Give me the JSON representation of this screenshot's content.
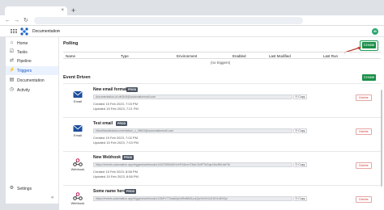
{
  "browser": {
    "tab_close": "×",
    "new_tab": "+",
    "back_glyph": "←",
    "forward_glyph": "→",
    "reload_glyph": "↻"
  },
  "header": {
    "workspace": "Documentation",
    "chevron": "⌄",
    "avatar_initial": "M"
  },
  "sidebar": {
    "items": [
      {
        "label": "Home",
        "icon": "⌂"
      },
      {
        "label": "Tasks",
        "icon": "☑"
      },
      {
        "label": "Pipeline",
        "icon": "⇄"
      },
      {
        "label": "Triggers",
        "icon": "⚡"
      },
      {
        "label": "Documentation",
        "icon": "▤"
      },
      {
        "label": "Activity",
        "icon": "◷"
      }
    ],
    "settings": {
      "label": "Settings",
      "icon": "⚙"
    },
    "collapse_glyph": "«",
    "active_index": 3
  },
  "polling": {
    "title": "Polling",
    "create_label": "Create",
    "columns": [
      "Name",
      "Type",
      "Environment",
      "Enabled",
      "Last Modified",
      "Last Run"
    ],
    "empty_text": "(no triggers)"
  },
  "event_driven": {
    "title": "Event Driven",
    "create_label": "Create",
    "cards": [
      {
        "name": "New email format",
        "badge": "PROD",
        "kind": "Email",
        "url": "documentation-id.cfe3b1f@automationmail.com",
        "copy": "Copy",
        "created": "Created 15 Feb 2023, 7:03 PM",
        "updated": "Updated 15 Feb 2023, 7:21 PM",
        "delete": "Delete"
      },
      {
        "name": "Test email",
        "badge": "PROD",
        "kind": "Email",
        "url": "b5ea9baddeasdocumentation_c_0ffb23@automationmail.com",
        "copy": "Copy",
        "created": "Created 15 Feb 2023, 7:02 PM",
        "updated": "Updated 15 Feb 2023, 7:03 PM",
        "delete": "Delete"
      },
      {
        "name": "New Webhook",
        "badge": "PROD",
        "kind": "Webhook",
        "url": "https://events.automation.app/triggers/webhook/v1/0AT2B5U6XvHrFN1bvH7MzC6I4PTkGqeJ4knRtKdvFN/",
        "copy": "Copy",
        "created": "Created 15 Feb 2023, 8:58 PM",
        "updated": "Updated 15 Feb 2023, 8:58 PM",
        "delete": "Delete"
      },
      {
        "name": "Some name here",
        "badge": "PROD",
        "kind": "Webhook",
        "url": "https://events.automation.app/triggers/webhook/v1/3kPxT72aaMq0mRnB8ZtLu4QwVsYeXcD1fGhJiKlOp/",
        "copy": "Copy",
        "created": "",
        "updated": "",
        "delete": "Delete"
      }
    ]
  },
  "colors": {
    "primary_green": "#1a8f47",
    "active_blue": "#1a56c4",
    "delete_red": "#d13b3b",
    "badge_gray": "#4b5563"
  }
}
